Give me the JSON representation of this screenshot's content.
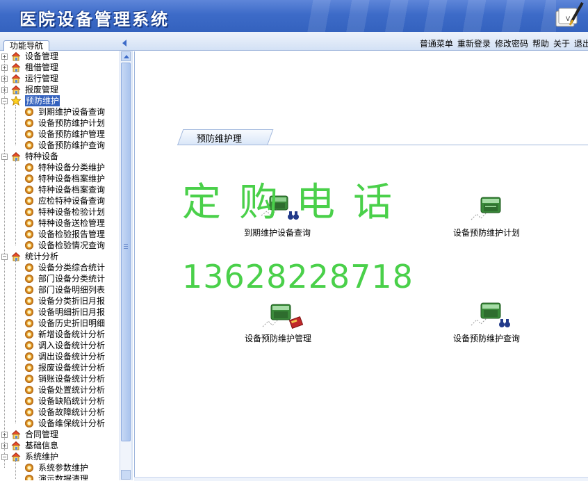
{
  "app": {
    "title": "医院设备管理系统"
  },
  "toolbar": {
    "nav_tab": "功能导航",
    "menu": [
      "普通菜单",
      "重新登录",
      "修改密码",
      "帮助",
      "关于",
      "退出"
    ]
  },
  "sidebar": {
    "groups": [
      {
        "label": "设备管理",
        "expanded": false,
        "items": []
      },
      {
        "label": "租借管理",
        "expanded": false,
        "items": []
      },
      {
        "label": "运行管理",
        "expanded": false,
        "items": []
      },
      {
        "label": "报废管理",
        "expanded": false,
        "items": []
      },
      {
        "label": "预防维护",
        "expanded": true,
        "selected": true,
        "icon": "star-icon",
        "items": [
          "到期维护设备查询",
          "设备预防维护计划",
          "设备预防维护管理",
          "设备预防维护查询"
        ]
      },
      {
        "label": "特种设备",
        "expanded": true,
        "items": [
          "特种设备分类维护",
          "特种设备档案维护",
          "特种设备档案查询",
          "应检特种设备查询",
          "特种设备检验计划",
          "特种设备送检管理",
          "设备检验报告管理",
          "设备检验情况查询"
        ]
      },
      {
        "label": "统计分析",
        "expanded": true,
        "items": [
          "设备分类综合统计",
          "部门设备分类统计",
          "部门设备明细列表",
          "设备分类折旧月报",
          "设备明细折旧月报",
          "设备历史折旧明细",
          "新增设备统计分析",
          "调入设备统计分析",
          "调出设备统计分析",
          "报废设备统计分析",
          "销账设备统计分析",
          "设备处置统计分析",
          "设备缺陷统计分析",
          "设备故障统计分析",
          "设备维保统计分析"
        ]
      },
      {
        "label": "合同管理",
        "expanded": false,
        "items": []
      },
      {
        "label": "基础信息",
        "expanded": false,
        "items": []
      },
      {
        "label": "系统维护",
        "expanded": true,
        "items": [
          "系统参数维护",
          "演示数据清理"
        ]
      }
    ]
  },
  "content": {
    "section_title": "预防维护理",
    "functions": [
      {
        "label": "到期维护设备查询",
        "icon": "binoculars-icon"
      },
      {
        "label": "设备预防维护计划",
        "icon": "machine-icon"
      },
      {
        "label": "设备预防维护管理",
        "icon": "book-icon"
      },
      {
        "label": "设备预防维护查询",
        "icon": "binoculars-icon"
      }
    ],
    "ad_text": "定购电话",
    "ad_phone": "13628228718"
  }
}
